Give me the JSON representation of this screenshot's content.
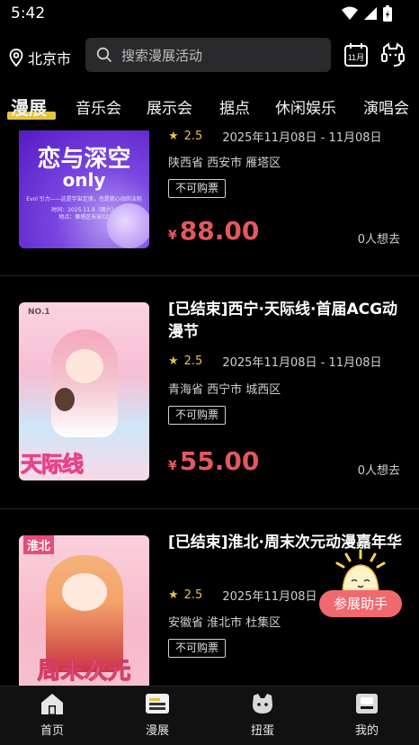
{
  "status": {
    "time": "5:42"
  },
  "header": {
    "location": "北京市",
    "search_placeholder": "搜索漫展活动",
    "calendar_label": "11月"
  },
  "tabs": [
    "漫展",
    "音乐会",
    "展示会",
    "据点",
    "休闲娱乐",
    "演唱会"
  ],
  "events": [
    {
      "title": "",
      "rating": "2.5",
      "date": "2025年11月08日 - 11月08日",
      "address": "陕西省 西安市 雁塔区",
      "badge": "不可购票",
      "price_symbol": "¥",
      "price": "88.00",
      "wants": "0人想去",
      "poster": {
        "line1": "恋与深空",
        "line2": "only",
        "line3": "Evol 引力——这是宇宙定律，也是我心动的法则",
        "line4": "时间：2025.11.8（周六）",
        "line5": "地点：雁塔区长安CC"
      }
    },
    {
      "title": "[已结束]西宁·天际线·首届ACG动漫节",
      "rating": "2.5",
      "date": "2025年11月08日 - 11月08日",
      "address": "青海省 西宁市 城西区",
      "badge": "不可购票",
      "price_symbol": "¥",
      "price": "55.00",
      "wants": "0人想去",
      "poster": {
        "line1": "天际线",
        "line2": "NO.1"
      }
    },
    {
      "title": "[已结束]淮北·周末次元动漫嘉年华",
      "rating": "2.5",
      "date": "2025年11月08日",
      "address": "安徽省 淮北市 杜集区",
      "badge": "不可购票",
      "poster": {
        "line1": "淮北",
        "line2": "周末次元"
      }
    }
  ],
  "helper": {
    "label": "参展助手"
  },
  "bottom_nav": [
    {
      "label": "首页",
      "icon": "home-icon"
    },
    {
      "label": "漫展",
      "icon": "expo-icon"
    },
    {
      "label": "扭蛋",
      "icon": "gacha-icon"
    },
    {
      "label": "我的",
      "icon": "profile-icon"
    }
  ],
  "colors": {
    "accent": "#e6c437",
    "price": "#e2585f",
    "helper": "#ef6a6e"
  }
}
